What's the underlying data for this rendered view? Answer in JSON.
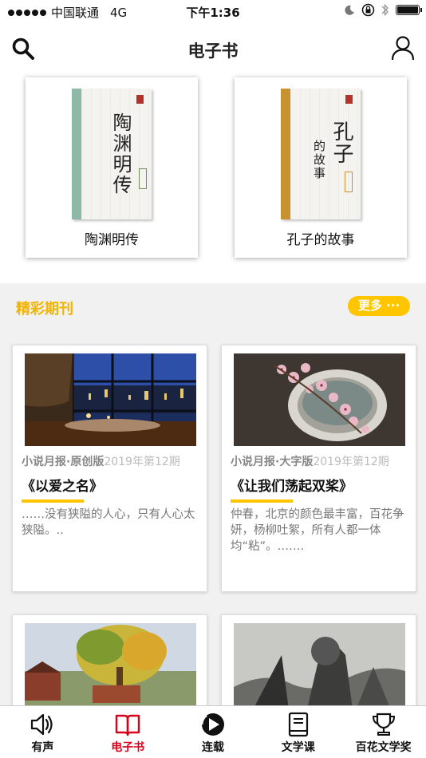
{
  "status_bar": {
    "carrier": "中国联通",
    "network": "4G",
    "time": "下午1:36"
  },
  "header": {
    "title": "电子书",
    "left_icon": "search-icon",
    "right_icon": "user-icon"
  },
  "books": [
    {
      "title": "陶渊明传",
      "cover_calligraphy": "陶渊明传",
      "spine_color": "#8fb8a8"
    },
    {
      "title": "孔子的故事",
      "cover_calligraphy": "孔子",
      "cover_sub": "的故事",
      "spine_color": "#c9922f"
    }
  ],
  "section": {
    "title": "精彩期刊",
    "more_label": "更多 ···"
  },
  "magazines": [
    {
      "source": "小说月报·原创版",
      "issue": "2019年第12期",
      "title": "《以爱之名》",
      "excerpt": "……没有狭隘的人心，只有人心太狭隘。.."
    },
    {
      "source": "小说月报·大字版",
      "issue": "2019年第12期",
      "title": "《让我们荡起双桨》",
      "excerpt": "仲春，北京的颜色最丰富，百花争妍，杨柳吐絮，所有人都一体均“粘”。……."
    },
    {
      "source": "",
      "issue": "",
      "title": "",
      "excerpt": ""
    },
    {
      "source": "",
      "issue": "",
      "title": "",
      "excerpt": ""
    }
  ],
  "tabs": [
    {
      "label": "有声",
      "icon": "speaker-icon",
      "active": false
    },
    {
      "label": "电子书",
      "icon": "open-book-icon",
      "active": true
    },
    {
      "label": "连载",
      "icon": "play-circle-icon",
      "active": false
    },
    {
      "label": "文学课",
      "icon": "book-icon",
      "active": false
    },
    {
      "label": "百花文学奖",
      "icon": "trophy-icon",
      "active": false
    }
  ],
  "colors": {
    "accent": "#ffc600",
    "section_title": "#f2b300",
    "active_tab": "#d9001b"
  }
}
